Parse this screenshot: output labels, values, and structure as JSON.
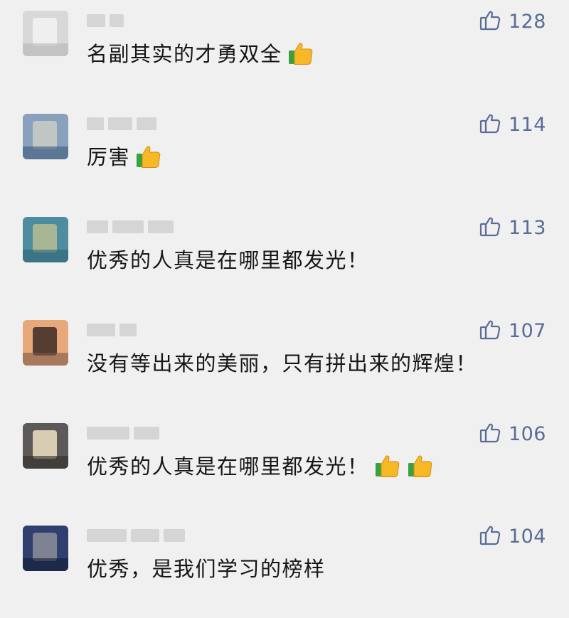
{
  "comments": [
    {
      "likes": "128",
      "text": "名副其实的才勇双全",
      "emoji_count": 1,
      "avatar": {
        "bg": "#d8d8d8",
        "a": "#f3f3f3",
        "b": "#b6b6b6"
      }
    },
    {
      "likes": "114",
      "text": "厉害",
      "emoji_count": 1,
      "avatar": {
        "bg": "#8aa1bd",
        "a": "#c9ccc5",
        "b": "#3e5a7a"
      }
    },
    {
      "likes": "113",
      "text": "优秀的人真是在哪里都发光！",
      "emoji_count": 0,
      "avatar": {
        "bg": "#4e8da0",
        "a": "#b9bd93",
        "b": "#2f6477"
      }
    },
    {
      "likes": "107",
      "text": "没有等出来的美丽，只有拼出来的辉煌！",
      "emoji_count": 0,
      "avatar": {
        "bg": "#e8a97a",
        "a": "#3b2a24",
        "b": "#7d5a48"
      }
    },
    {
      "likes": "106",
      "text": "优秀的人真是在哪里都发光！",
      "emoji_count": 2,
      "avatar": {
        "bg": "#5c5a58",
        "a": "#efe1c6",
        "b": "#2e2c2a"
      }
    },
    {
      "likes": "104",
      "text": "优秀，是我们学习的榜样",
      "emoji_count": 0,
      "avatar": {
        "bg": "#2f3f6f",
        "a": "#8c8e99",
        "b": "#101a33"
      }
    }
  ],
  "icons": {
    "like": "thumbs-up-outline-icon",
    "emoji": "thumbs-up-emoji-icon"
  },
  "colors": {
    "like_text": "#5a6b96",
    "comment_text": "#161616",
    "background": "#f0f0f0"
  }
}
